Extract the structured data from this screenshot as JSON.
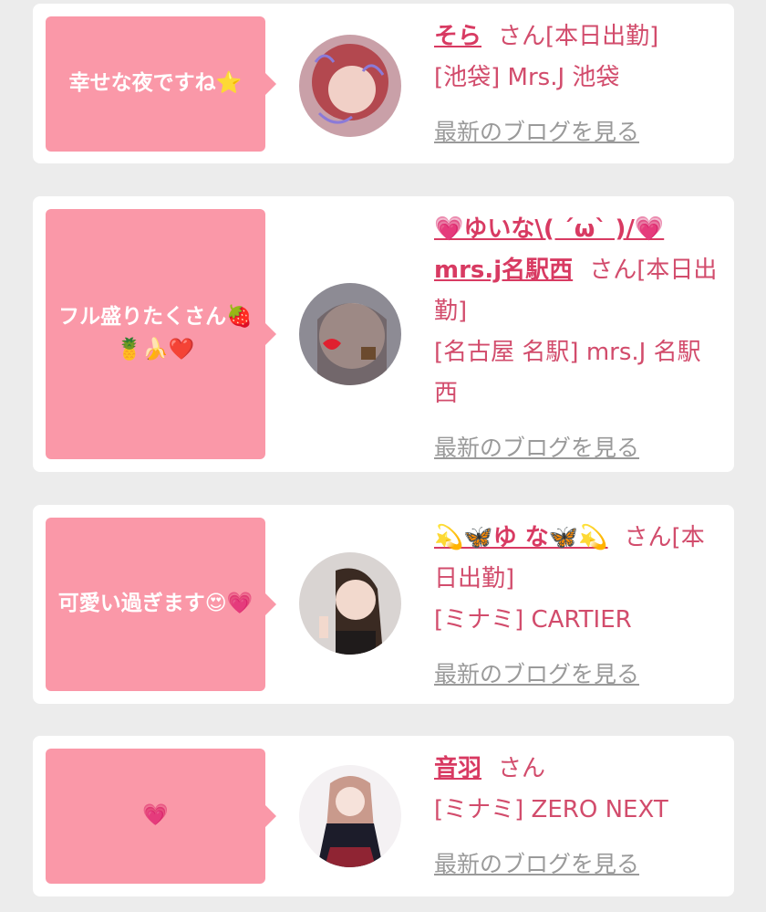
{
  "colors": {
    "bubble": "#fa98a8",
    "name": "#d83a62",
    "text": "#d24c6c",
    "link": "#9a9a9a",
    "background": "#ececec"
  },
  "posts": [
    {
      "bubble_text": "幸せな夜ですね⭐",
      "name": "そら",
      "suffix": "さん[本日出勤]",
      "location": "[池袋] Mrs.J 池袋",
      "blog_link": "最新のブログを見る"
    },
    {
      "bubble_text": "フル盛りたくさん🍓🍍🍌❤️",
      "name": "💗ゆいな\\( ´ω` )/💗mrs.j名駅西",
      "suffix": "さん[本日出勤]",
      "location": "[名古屋 名駅] mrs.J 名駅西",
      "blog_link": "最新のブログを見る"
    },
    {
      "bubble_text": "可愛い過ぎます😍💗",
      "name": "💫🦋ゆ な🦋💫",
      "suffix": "さん[本日出勤]",
      "location": "[ミナミ] CARTIER",
      "blog_link": "最新のブログを見る"
    },
    {
      "bubble_text": "💗",
      "name": "音羽",
      "suffix": "さん",
      "location": "[ミナミ] ZERO NEXT",
      "blog_link": "最新のブログを見る"
    }
  ]
}
